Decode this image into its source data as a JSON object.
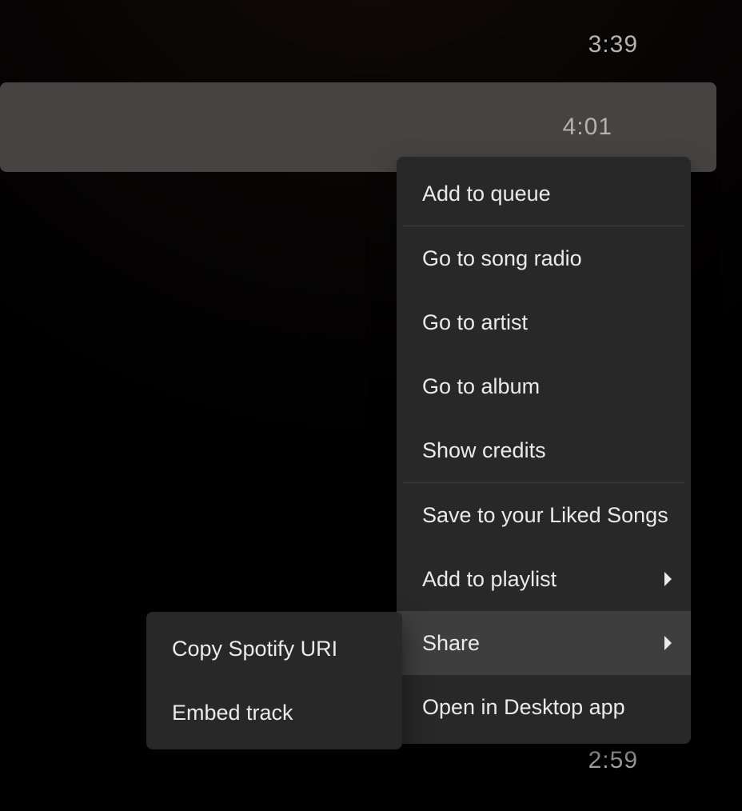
{
  "tracks": {
    "row0_duration": "3:39",
    "row1_duration": "4:01",
    "row2_duration": "2:59"
  },
  "context_menu": {
    "add_to_queue": "Add to queue",
    "go_to_song_radio": "Go to song radio",
    "go_to_artist": "Go to artist",
    "go_to_album": "Go to album",
    "show_credits": "Show credits",
    "save_liked": "Save to your Liked Songs",
    "add_to_playlist": "Add to playlist",
    "share": "Share",
    "open_desktop": "Open in Desktop app"
  },
  "share_submenu": {
    "copy_uri": "Copy Spotify URI",
    "embed_track": "Embed track"
  }
}
